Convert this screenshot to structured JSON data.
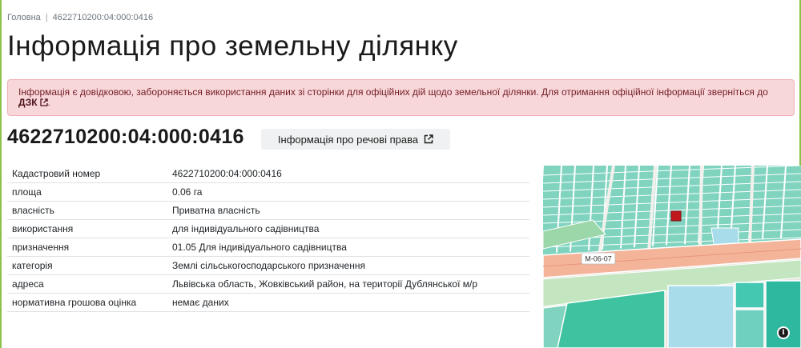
{
  "breadcrumb": {
    "home": "Головна",
    "separator": "|",
    "current": "4622710200:04:000:0416"
  },
  "page_title": "Інформація про земельну ділянку",
  "alert": {
    "text": "Інформація є довідковою, забороняється використання даних зі сторінки для офіційних дій щодо земельної ділянки. Для отримання офіційної інформації зверніться до ",
    "link": "ДЗК",
    "suffix": "."
  },
  "parcel": {
    "id": "4622710200:04:000:0416",
    "rights_button": "Інформація про речові права"
  },
  "table": [
    {
      "key": "Кадастровий номер",
      "value": "4622710200:04:000:0416"
    },
    {
      "key": "площа",
      "value": "0.06 га"
    },
    {
      "key": "власність",
      "value": "Приватна власність"
    },
    {
      "key": "використання",
      "value": "для індивідуального садівництва"
    },
    {
      "key": "призначення",
      "value": "01.05 Для індивідуального садівництва"
    },
    {
      "key": "категорія",
      "value": "Землі сільськогосподарського призначення"
    },
    {
      "key": "адреса",
      "value": "Львівська область, Жовківський район, на території Дублянської м/р"
    },
    {
      "key": "нормативна грошова оцінка",
      "value": "немає даних"
    }
  ],
  "map": {
    "road_label": "М-06-07",
    "info_icon": "info-icon",
    "colors": {
      "parcels": "#7fd3bf",
      "selected": "#c0171c",
      "road": "#f4b49a",
      "water": "#a9dcea",
      "industrial": "#45c8b2"
    }
  },
  "colors": {
    "alert_bg": "#f8d7da",
    "alert_text": "#721c24",
    "frame": "#8bc34a"
  }
}
